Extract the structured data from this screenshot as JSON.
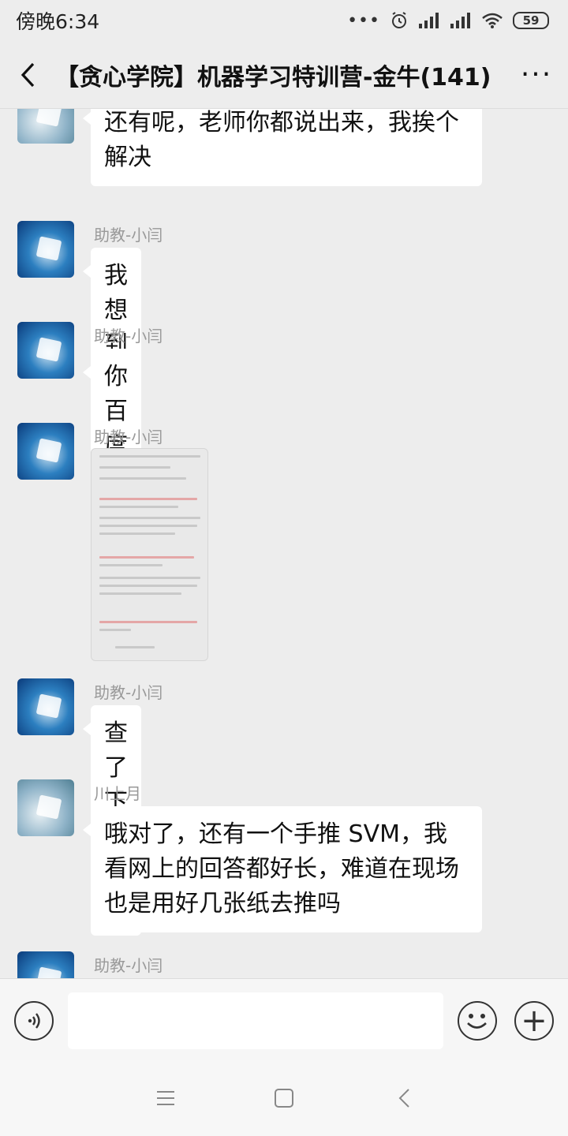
{
  "status_bar": {
    "time": "傍晚6:34",
    "battery": "59"
  },
  "header": {
    "title": "【贪心学院】机器学习特训营-金牛(141)"
  },
  "messages": [
    {
      "sender": "",
      "text": "还有呢，老师你都说出来，我挨个解决"
    },
    {
      "sender": "助教-小闫",
      "text": "我想到这个三个"
    },
    {
      "sender": "助教-小闫",
      "text": "你百度下"
    },
    {
      "sender": "助教-小闫",
      "type": "image"
    },
    {
      "sender": "助教-小闫",
      "text": "查了下挺多的"
    },
    {
      "sender": "川上月",
      "text": "哦对了，还有一个手推 SVM，我看网上的回答都好长，难道在现场也是用好几张纸去推吗"
    },
    {
      "sender": "助教-小闫",
      "text": ""
    }
  ],
  "input": {
    "placeholder": ""
  }
}
